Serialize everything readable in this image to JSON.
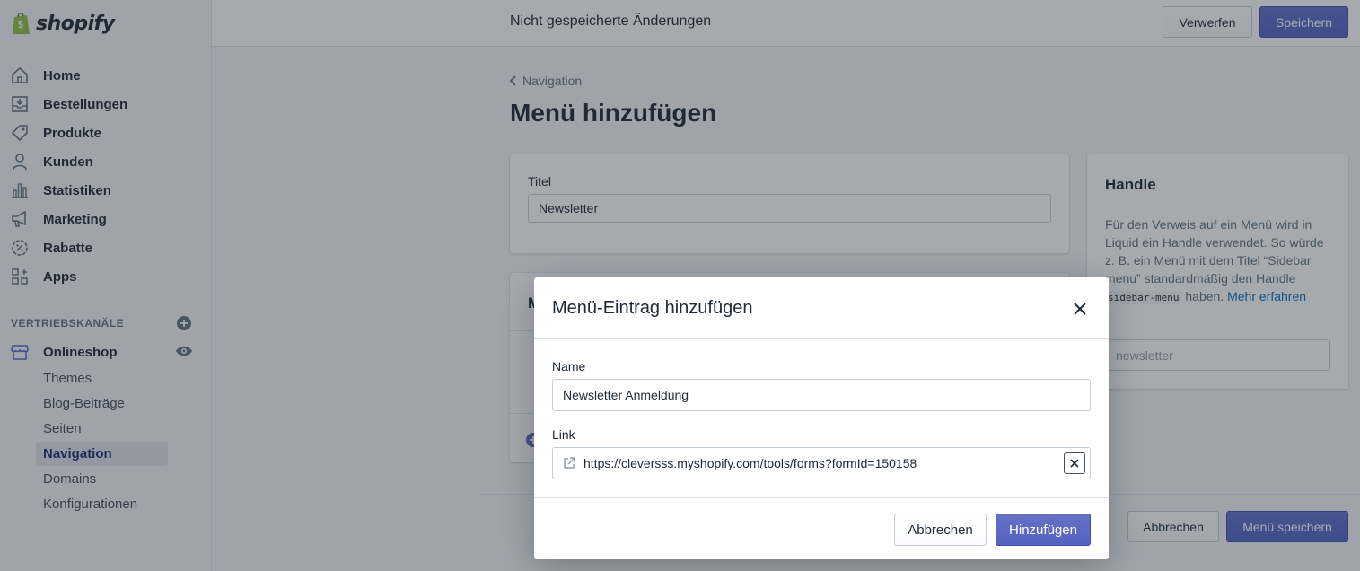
{
  "brand": {
    "name": "shopify",
    "color": "#95bf47"
  },
  "topbar": {
    "status": "Nicht gespeicherte Änderungen",
    "discard_label": "Verwerfen",
    "save_label": "Speichern"
  },
  "sidebar": {
    "items": [
      {
        "label": "Home",
        "icon": "home-icon"
      },
      {
        "label": "Bestellungen",
        "icon": "orders-icon"
      },
      {
        "label": "Produkte",
        "icon": "tag-icon"
      },
      {
        "label": "Kunden",
        "icon": "person-icon"
      },
      {
        "label": "Statistiken",
        "icon": "bar-chart-icon"
      },
      {
        "label": "Marketing",
        "icon": "megaphone-icon"
      },
      {
        "label": "Rabatte",
        "icon": "discount-icon"
      },
      {
        "label": "Apps",
        "icon": "apps-icon"
      }
    ],
    "channels_label": "VERTRIEBSKANÄLE",
    "channel": {
      "label": "Onlineshop",
      "icon": "store-icon"
    },
    "subitems": [
      "Themes",
      "Blog-Beiträge",
      "Seiten",
      "Navigation",
      "Domains",
      "Konfigurationen"
    ],
    "active_subitem": "Navigation"
  },
  "main": {
    "breadcrumb": "Navigation",
    "title": "Menü hinzufügen",
    "title_card": {
      "label": "Titel",
      "value": "Newsletter"
    },
    "menu_card": {
      "header": "M"
    },
    "handle_card": {
      "header": "Handle",
      "desc_part1": "Für den Verweis auf ein Menü wird in Liquid ein Handle verwendet. So würde z. B. ein Menü mit dem Titel “Sidebar menu” standardmäßig den Handle ",
      "desc_code": "sidebar-menu",
      "desc_part2": " haben. ",
      "desc_link": "Mehr erfahren",
      "value": "newsletter"
    },
    "footer": {
      "cancel_label": "Abbrechen",
      "save_label": "Menü speichern"
    }
  },
  "modal": {
    "title": "Menü-Eintrag hinzufügen",
    "name_label": "Name",
    "name_value": "Newsletter Anmeldung",
    "link_label": "Link",
    "link_value": "https://cleversss.myshopify.com/tools/forms?formId=150158",
    "cancel_label": "Abbrechen",
    "add_label": "Hinzufügen"
  },
  "colors": {
    "primary": "#5c6ac4",
    "link": "#006fbb",
    "active_nav": "#202e78"
  }
}
